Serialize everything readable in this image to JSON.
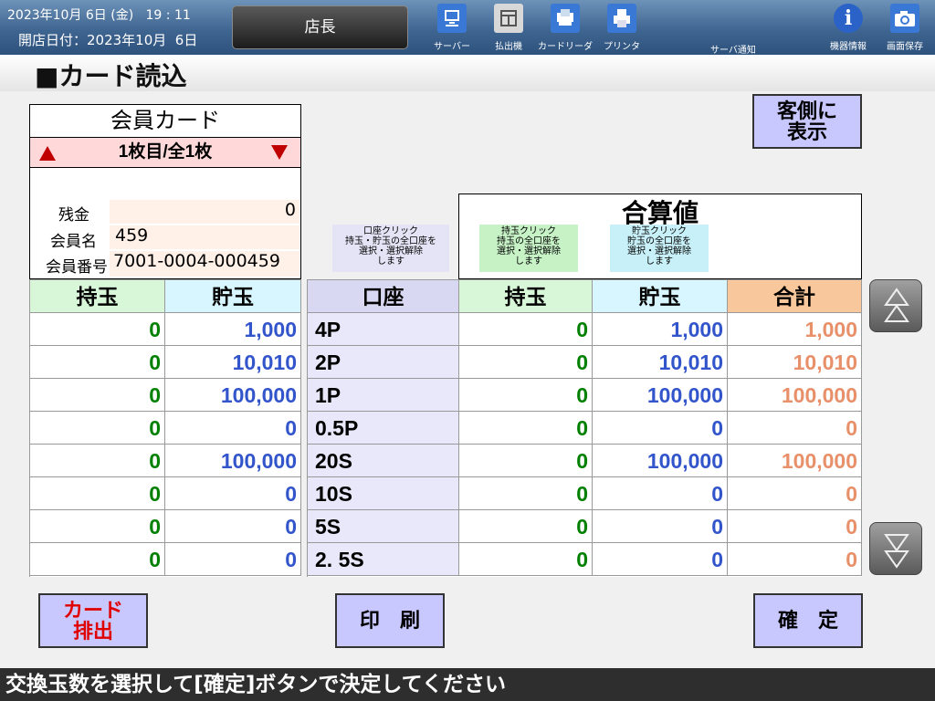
{
  "topbar": {
    "datetime": "2023年10月 6日 (金)   19 : 11",
    "open_date": "開店日付：2023年10月  6日",
    "role": "店長",
    "tools": [
      {
        "label": "サーバー",
        "icon": "server-icon"
      },
      {
        "label": "払出機",
        "icon": "dispenser-icon"
      },
      {
        "label": "カードリーダ",
        "icon": "card-reader-icon"
      },
      {
        "label": "プリンタ",
        "icon": "printer-icon"
      }
    ],
    "server_notice": "サーバ通知",
    "device_info": "機器情報",
    "screen_save": "画面保存"
  },
  "header": {
    "title": "■カード読込"
  },
  "card": {
    "title": "会員カード",
    "page": "1枚目/全1枚",
    "balance_label": "残金",
    "balance": "0",
    "name_label": "会員名",
    "name": "459",
    "number_label": "会員番号",
    "number": "7001-0004-000459"
  },
  "customer_display": "客側に\n表示",
  "summary_title": "合算値",
  "hints": {
    "account": "口座クリック\n持玉・貯玉の全口座を\n選択・選択解除\nします",
    "mochi": "持玉クリック\n持玉の全口座を\n選択・選択解除\nします",
    "choki": "貯玉クリック\n貯玉の全口座を\n選択・選択解除\nします"
  },
  "headers": {
    "mochi": "持玉",
    "choki": "貯玉",
    "account": "口座",
    "total": "合計"
  },
  "rows": [
    {
      "mochi": "0",
      "choki": "1,000",
      "account": "4P",
      "s_mochi": "0",
      "s_choki": "1,000",
      "total": "1,000"
    },
    {
      "mochi": "0",
      "choki": "10,010",
      "account": "2P",
      "s_mochi": "0",
      "s_choki": "10,010",
      "total": "10,010"
    },
    {
      "mochi": "0",
      "choki": "100,000",
      "account": "1P",
      "s_mochi": "0",
      "s_choki": "100,000",
      "total": "100,000"
    },
    {
      "mochi": "0",
      "choki": "0",
      "account": "0.5P",
      "s_mochi": "0",
      "s_choki": "0",
      "total": "0"
    },
    {
      "mochi": "0",
      "choki": "100,000",
      "account": "20S",
      "s_mochi": "0",
      "s_choki": "100,000",
      "total": "100,000"
    },
    {
      "mochi": "0",
      "choki": "0",
      "account": "10S",
      "s_mochi": "0",
      "s_choki": "0",
      "total": "0"
    },
    {
      "mochi": "0",
      "choki": "0",
      "account": "5S",
      "s_mochi": "0",
      "s_choki": "0",
      "total": "0"
    },
    {
      "mochi": "0",
      "choki": "0",
      "account": "2. 5S",
      "s_mochi": "0",
      "s_choki": "0",
      "total": "0"
    }
  ],
  "buttons": {
    "eject": "カード\n排出",
    "print": "印　刷",
    "confirm": "確　定"
  },
  "status": "交換玉数を選択して[確定]ボタンで決定してください",
  "colors": {
    "mochi": "#008000",
    "choki": "#3355cc",
    "total": "#e8906a",
    "accent": "#c00000"
  }
}
